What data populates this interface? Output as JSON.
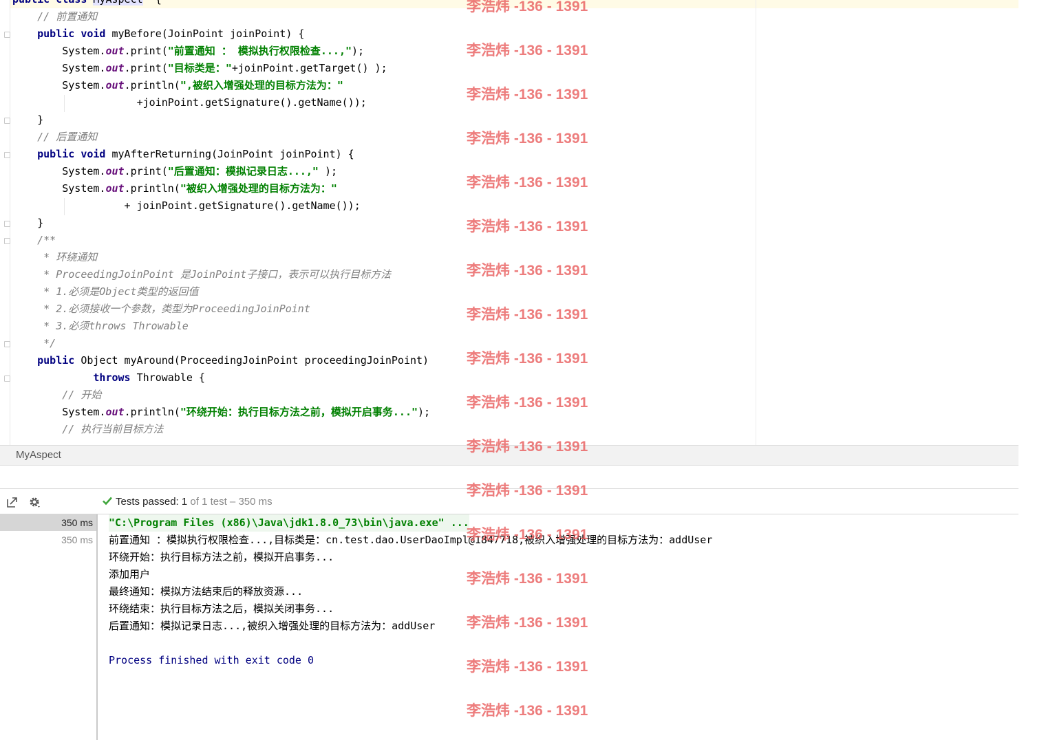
{
  "editor": {
    "lines": [
      [
        [
          "kw",
          "public class "
        ],
        [
          "hl",
          "MyAspect"
        ],
        [
          "",
          "  {"
        ]
      ],
      [
        [
          "cmt",
          "    // 前置通知"
        ]
      ],
      [
        [
          "kw",
          "    public void "
        ],
        [
          "",
          "myBefore(JoinPoint joinPoint) {"
        ]
      ],
      [
        [
          "",
          "        System."
        ],
        [
          "fld",
          "out"
        ],
        [
          "",
          ".print("
        ],
        [
          "str",
          "\"前置通知 ： 模拟执行权限检查...,\""
        ],
        [
          "",
          ");"
        ]
      ],
      [
        [
          "",
          "        System."
        ],
        [
          "fld",
          "out"
        ],
        [
          "",
          ".print("
        ],
        [
          "str",
          "\"目标类是：\""
        ],
        [
          "",
          "+joinPoint.getTarget() );"
        ]
      ],
      [
        [
          "",
          "        System."
        ],
        [
          "fld",
          "out"
        ],
        [
          "",
          ".println("
        ],
        [
          "str",
          "\",被织入增强处理的目标方法为：\""
        ]
      ],
      [
        [
          "",
          "                    +joinPoint.getSignature().getName());"
        ]
      ],
      [
        [
          "",
          "    }"
        ]
      ],
      [
        [
          "cmt",
          "    // 后置通知"
        ]
      ],
      [
        [
          "kw",
          "    public void "
        ],
        [
          "",
          "myAfterReturning(JoinPoint joinPoint) {"
        ]
      ],
      [
        [
          "",
          "        System."
        ],
        [
          "fld",
          "out"
        ],
        [
          "",
          ".print("
        ],
        [
          "str",
          "\"后置通知：模拟记录日志...,\""
        ],
        [
          "",
          " );"
        ]
      ],
      [
        [
          "",
          "        System."
        ],
        [
          "fld",
          "out"
        ],
        [
          "",
          ".println("
        ],
        [
          "str",
          "\"被织入增强处理的目标方法为：\""
        ]
      ],
      [
        [
          "",
          "                  + joinPoint.getSignature().getName());"
        ]
      ],
      [
        [
          "",
          "    }"
        ]
      ],
      [
        [
          "cmt",
          "    /**"
        ]
      ],
      [
        [
          "cmt",
          "     * 环绕通知"
        ]
      ],
      [
        [
          "cmt",
          "     * ProceedingJoinPoint 是JoinPoint子接口，表示可以执行目标方法"
        ]
      ],
      [
        [
          "cmt",
          "     * 1.必须是Object类型的返回值"
        ]
      ],
      [
        [
          "cmt",
          "     * 2.必须接收一个参数，类型为ProceedingJoinPoint"
        ]
      ],
      [
        [
          "cmt",
          "     * 3.必须throws Throwable"
        ]
      ],
      [
        [
          "cmt",
          "     */"
        ]
      ],
      [
        [
          "kw",
          "    public "
        ],
        [
          "",
          "Object myAround(ProceedingJoinPoint proceedingJoinPoint)"
        ]
      ],
      [
        [
          "kw",
          "             throws "
        ],
        [
          "",
          "Throwable {"
        ]
      ],
      [
        [
          "cmt",
          "        // 开始"
        ]
      ],
      [
        [
          "",
          "        System."
        ],
        [
          "fld",
          "out"
        ],
        [
          "",
          ".println("
        ],
        [
          "str",
          "\"环绕开始：执行目标方法之前，模拟开启事务...\""
        ],
        [
          "",
          ");"
        ]
      ],
      [
        [
          "cmt",
          "        // 执行当前目标方法"
        ]
      ]
    ]
  },
  "breadcrumb": {
    "label": "MyAspect"
  },
  "run": {
    "toolbar": {
      "export_icon": "export-icon",
      "settings_icon": "gear-icon",
      "status_prefix": "Tests passed: ",
      "passed_count": "1",
      "status_suffix": " of 1 test – 350 ms"
    },
    "tree": [
      {
        "label": "350 ms",
        "selected": true
      },
      {
        "label": "350 ms",
        "selected": false
      }
    ],
    "console": {
      "command": "\"C:\\Program Files (x86)\\Java\\jdk1.8.0_73\\bin\\java.exe\" ...",
      "lines": [
        "前置通知 ：模拟执行权限检查...,目标类是：cn.test.dao.UserDaoImpl@1847718,被织入增强处理的目标方法为：addUser",
        "环绕开始：执行目标方法之前，模拟开启事务...",
        "添加用户",
        "最终通知：模拟方法结束后的释放资源...",
        "环绕结束：执行目标方法之后，模拟关闭事务...",
        "后置通知：模拟记录日志...,被织入增强处理的目标方法为：addUser"
      ],
      "exit_message": "Process finished with exit code 0"
    }
  },
  "watermark": {
    "text": "李浩炜 -136 - 1391",
    "color": "#e85c5c",
    "count": 17
  }
}
